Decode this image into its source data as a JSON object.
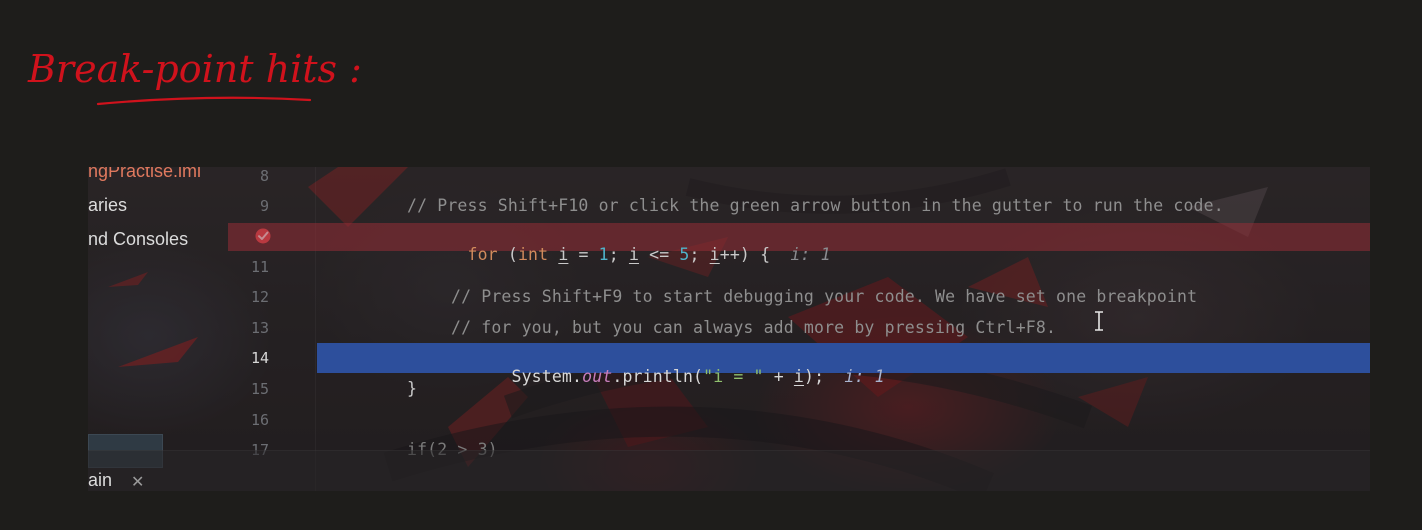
{
  "annotation": {
    "text": "Break-point hits :"
  },
  "project_tree": {
    "items": [
      "ngPractise.iml",
      "aries",
      "nd Consoles"
    ]
  },
  "editor": {
    "line_numbers": [
      "8",
      "9",
      "",
      "11",
      "12",
      "13",
      "14",
      "15",
      "16",
      "17"
    ],
    "breakpoint_line": "10",
    "current_line": "14",
    "lines": {
      "l9": "// Press Shift+F10 or click the green arrow button in the gutter to run the code.",
      "l10_kw_for": "for",
      "l10_paren": " (",
      "l10_kw_int": "int",
      "l10_var_i1": "i",
      "l10_eq": " = ",
      "l10_one": "1",
      "l10_semi1": "; ",
      "l10_var_i2": "i",
      "l10_le": " <= ",
      "l10_five": "5",
      "l10_semi2": "; ",
      "l10_var_i3": "i",
      "l10_inc": "++) {",
      "l10_inlay": "i: 1",
      "l12": "// Press Shift+F9 to start debugging your code. We have set one breakpoint",
      "l13": "// for you, but you can always add more by pressing Ctrl+F8.",
      "l14_system": "System.",
      "l14_out": "out",
      "l14_println": ".println(",
      "l14_str": "\"i = \"",
      "l14_plus": " + ",
      "l14_var": "i",
      "l14_end": ");",
      "l14_inlay": "i: 1",
      "l15": "}",
      "l17": "if(2 > 3)"
    }
  },
  "bottom_tab": {
    "label": "ain",
    "close": "✕"
  },
  "colors": {
    "breakpoint": "#e5484d",
    "execution_line": "#2d4f9c",
    "annotation_ink": "#d0121c"
  }
}
